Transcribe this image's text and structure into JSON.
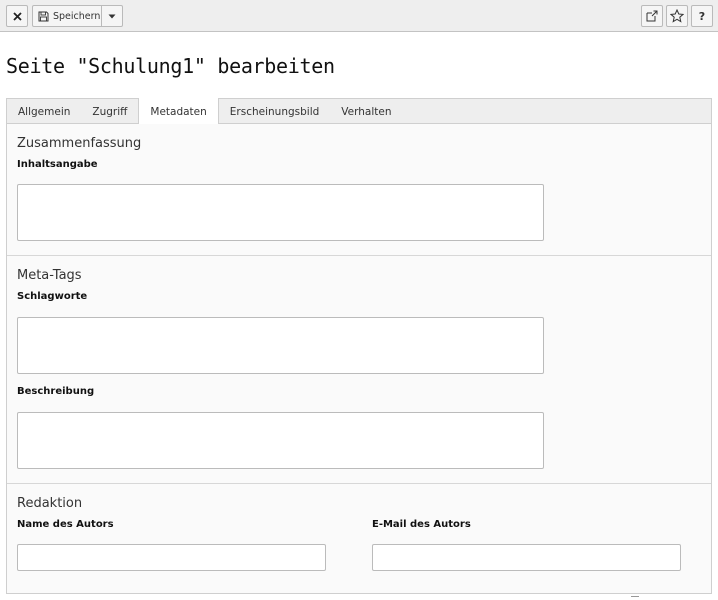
{
  "toolbar": {
    "close_icon": "close-icon",
    "save_icon": "save-disk-icon",
    "save_label": "Speichern",
    "split_icon": "caret-down-icon",
    "open_icon": "external-link-icon",
    "star_icon": "star-icon",
    "help_label": "?"
  },
  "page": {
    "title": "Seite \"Schulung1\" bearbeiten"
  },
  "tabs": [
    {
      "label": "Allgemein",
      "active": false
    },
    {
      "label": "Zugriff",
      "active": false
    },
    {
      "label": "Metadaten",
      "active": true
    },
    {
      "label": "Erscheinungsbild",
      "active": false
    },
    {
      "label": "Verhalten",
      "active": false
    }
  ],
  "sections": {
    "summary": {
      "title": "Zusammenfassung",
      "fields": {
        "abstract": {
          "label": "Inhaltsangabe",
          "value": ""
        }
      }
    },
    "meta": {
      "title": "Meta-Tags",
      "fields": {
        "keywords": {
          "label": "Schlagworte",
          "value": ""
        },
        "description": {
          "label": "Beschreibung",
          "value": ""
        }
      }
    },
    "editorial": {
      "title": "Redaktion",
      "fields": {
        "author": {
          "label": "Name des Autors",
          "value": ""
        },
        "author_email": {
          "label": "E-Mail des Autors",
          "value": ""
        }
      }
    }
  }
}
